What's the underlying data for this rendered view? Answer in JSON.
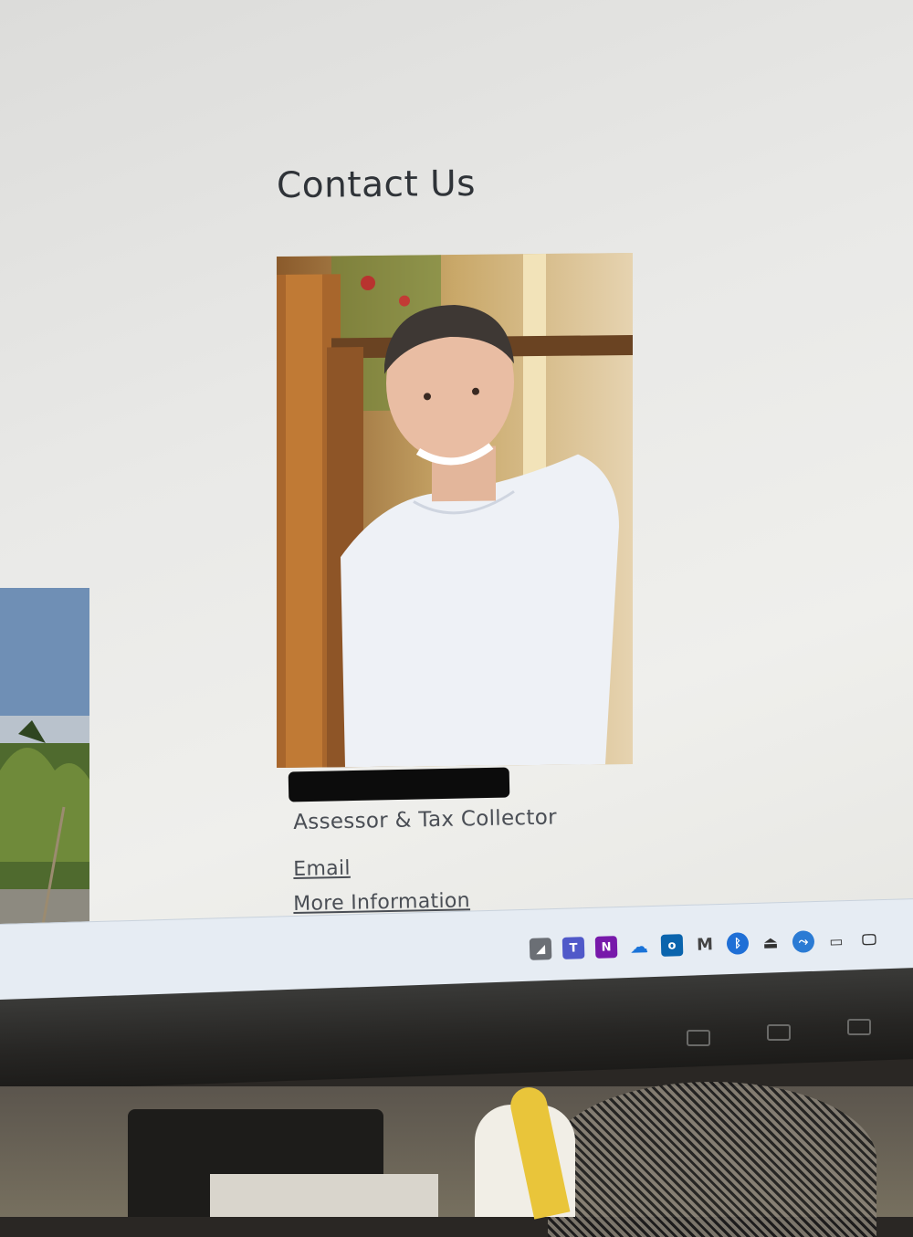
{
  "page": {
    "title": "Contact Us"
  },
  "contact": {
    "job_title": "Assessor & Tax Collector",
    "email_label": "Email",
    "more_info_label": "More Information"
  },
  "taskbar": {
    "tray_icons": [
      "remote-desktop-icon",
      "teams-icon",
      "onenote-icon",
      "onedrive-icon",
      "outlook-icon",
      "app-m-icon",
      "bluetooth-icon",
      "usb-icon",
      "share-icon",
      "battery-icon",
      "network-icon"
    ],
    "glyphs": {
      "onenote": "N",
      "outlook": "o",
      "m": "M"
    }
  },
  "colors": {
    "text": "#4a4e55",
    "heading": "#2f3338",
    "taskbar": "#e6ecf3"
  }
}
